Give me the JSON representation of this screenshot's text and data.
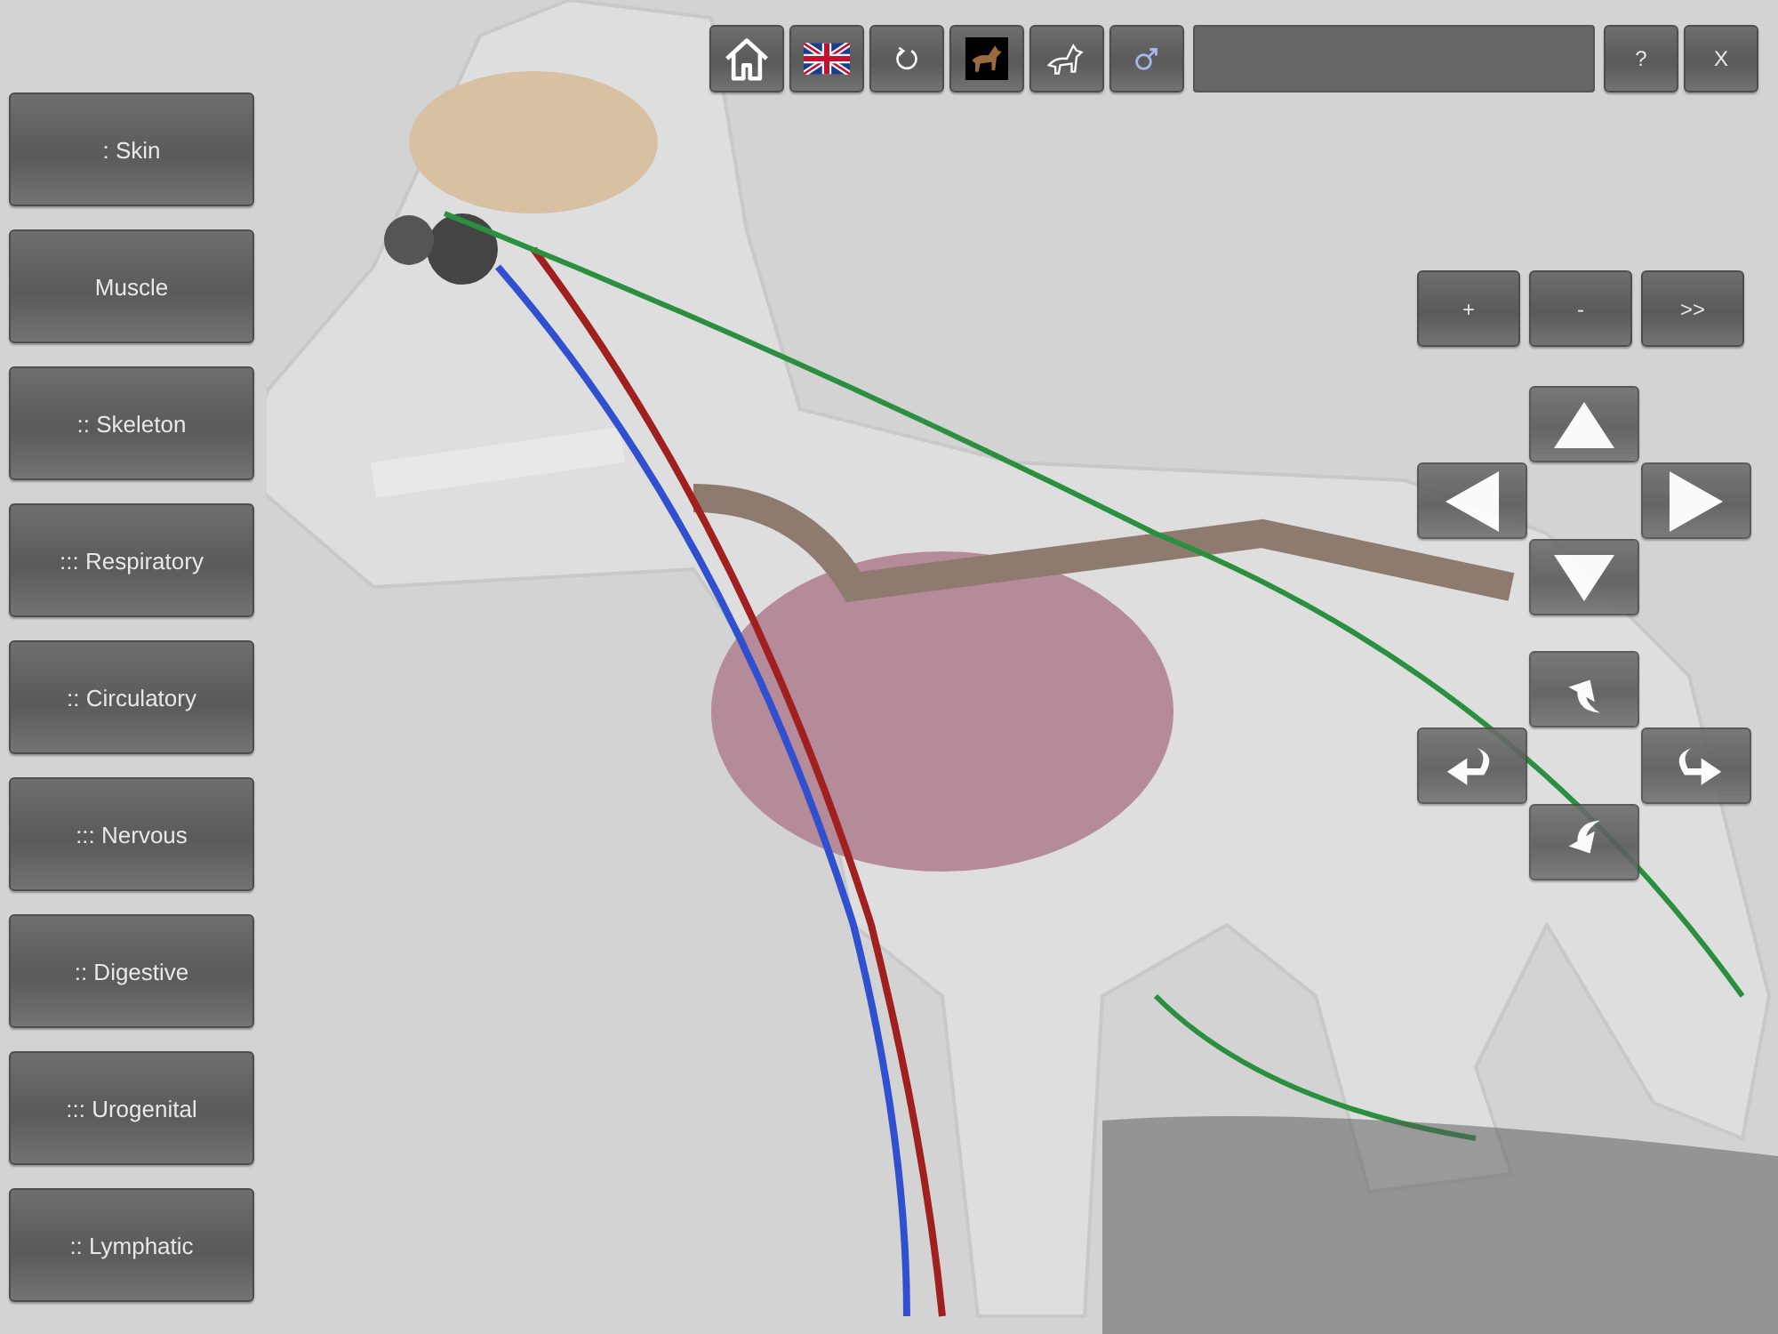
{
  "layers": [
    {
      "label": ": Skin"
    },
    {
      "label": "Muscle"
    },
    {
      "label": ":: Skeleton"
    },
    {
      "label": "::: Respiratory"
    },
    {
      "label": ":: Circulatory"
    },
    {
      "label": "::: Nervous"
    },
    {
      "label": ":: Digestive"
    },
    {
      "label": "::: Urogenital"
    },
    {
      "label": ":: Lymphatic"
    }
  ],
  "toolbar": {
    "help": "?",
    "close": "X"
  },
  "zoom_buttons": [
    "+",
    "-",
    ">>"
  ]
}
